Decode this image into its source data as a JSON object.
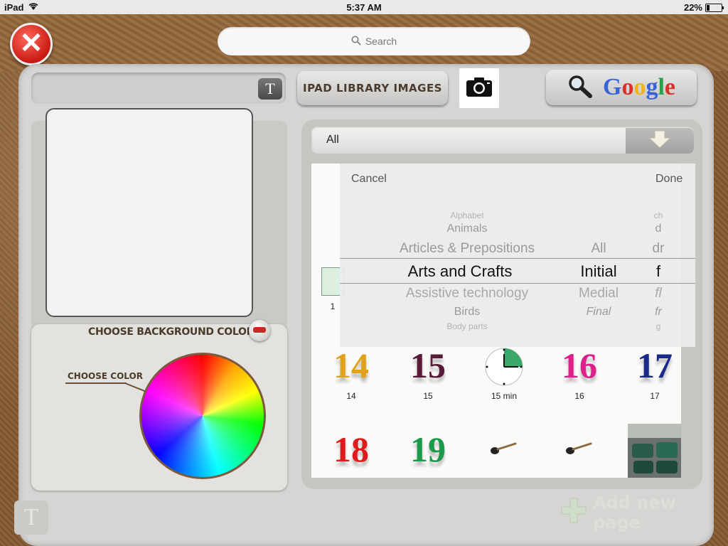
{
  "status_bar": {
    "device": "iPad",
    "time": "5:37 AM",
    "battery": "22%"
  },
  "search": {
    "placeholder": "Search"
  },
  "toolbar": {
    "text_button": "T",
    "library_label": "IPAD LIBRARY IMAGES",
    "google_label": "Google"
  },
  "color_panel": {
    "title": "CHOOSE BACKGROUND COLOR",
    "choose_color": "CHOOSE COLOR"
  },
  "category": {
    "selected": "All"
  },
  "picker": {
    "cancel": "Cancel",
    "done": "Done",
    "col1": [
      "Alphabet",
      "Animals",
      "Articles & Prepositions",
      "Arts and Crafts",
      "Assistive technology",
      "Birds",
      "Body parts"
    ],
    "col2": [
      "All",
      "Initial",
      "Medial",
      "Final"
    ],
    "col3": [
      "ch",
      "d",
      "dr",
      "f",
      "fl",
      "fr",
      "g"
    ]
  },
  "grid": {
    "row1": [
      {
        "num": "14",
        "label": "14",
        "color": "#e0a21a"
      },
      {
        "num": "15",
        "label": "15",
        "color": "#5a1a3a"
      },
      {
        "num": "",
        "label": "15 min",
        "color": "#2a9d5c"
      },
      {
        "num": "16",
        "label": "16",
        "color": "#e0208a"
      },
      {
        "num": "17",
        "label": "17",
        "color": "#1a2a8a"
      }
    ],
    "row2": [
      {
        "num": "18",
        "label": "",
        "color": "#e01a1a"
      },
      {
        "num": "19",
        "label": "",
        "color": "#1a9a4a"
      }
    ],
    "partial_label": "1"
  },
  "bottom": {
    "add_page": "Add new page",
    "t_ghost": "T"
  }
}
